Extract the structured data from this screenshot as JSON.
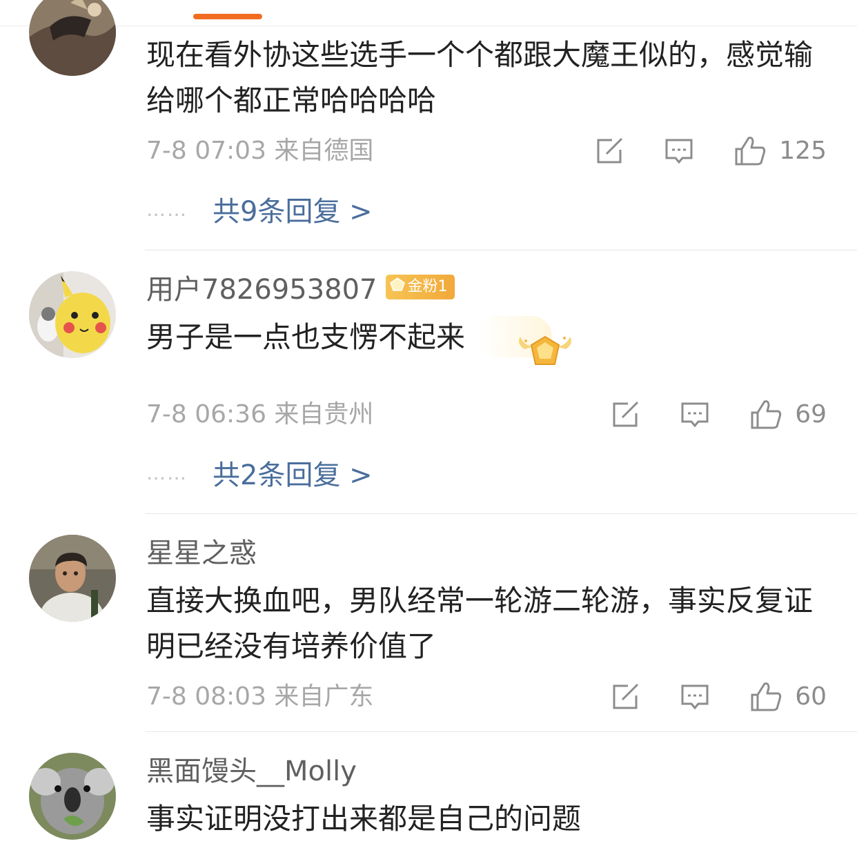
{
  "colors": {
    "tab_indicator": "#f26d22",
    "reply_link": "#4a6e9c",
    "meta_gray": "#a7a7a7",
    "icon_gray": "#8c8c8c",
    "badge_gold": "#f2a93b"
  },
  "comments": [
    {
      "username": "",
      "text": "现在看外协这些选手一个个都跟大魔王似的，感觉输给哪个都正常哈哈哈哈",
      "timestamp": "7-8 07:03 来自德国",
      "likes": "125",
      "replies": "共9条回复 >",
      "dots": "……"
    },
    {
      "username": "用户7826953807",
      "badge": "金粉1",
      "text": "男子是一点也支愣不起来",
      "timestamp": "7-8 06:36 来自贵州",
      "likes": "69",
      "replies": "共2条回复 >",
      "dots": "……"
    },
    {
      "username": "星星之惑",
      "text": "直接大换血吧，男队经常一轮游二轮游，事实反复证明已经没有培养价值了",
      "timestamp": "7-8 08:03 来自广东",
      "likes": "60"
    },
    {
      "username": "黑面馒头__Molly",
      "text": "事实证明没打出来都是自己的问题"
    }
  ],
  "icons": {
    "repost": "repost-icon",
    "comment": "comment-icon",
    "like": "thumbs-up-icon",
    "badge": "gold-gem-icon"
  }
}
